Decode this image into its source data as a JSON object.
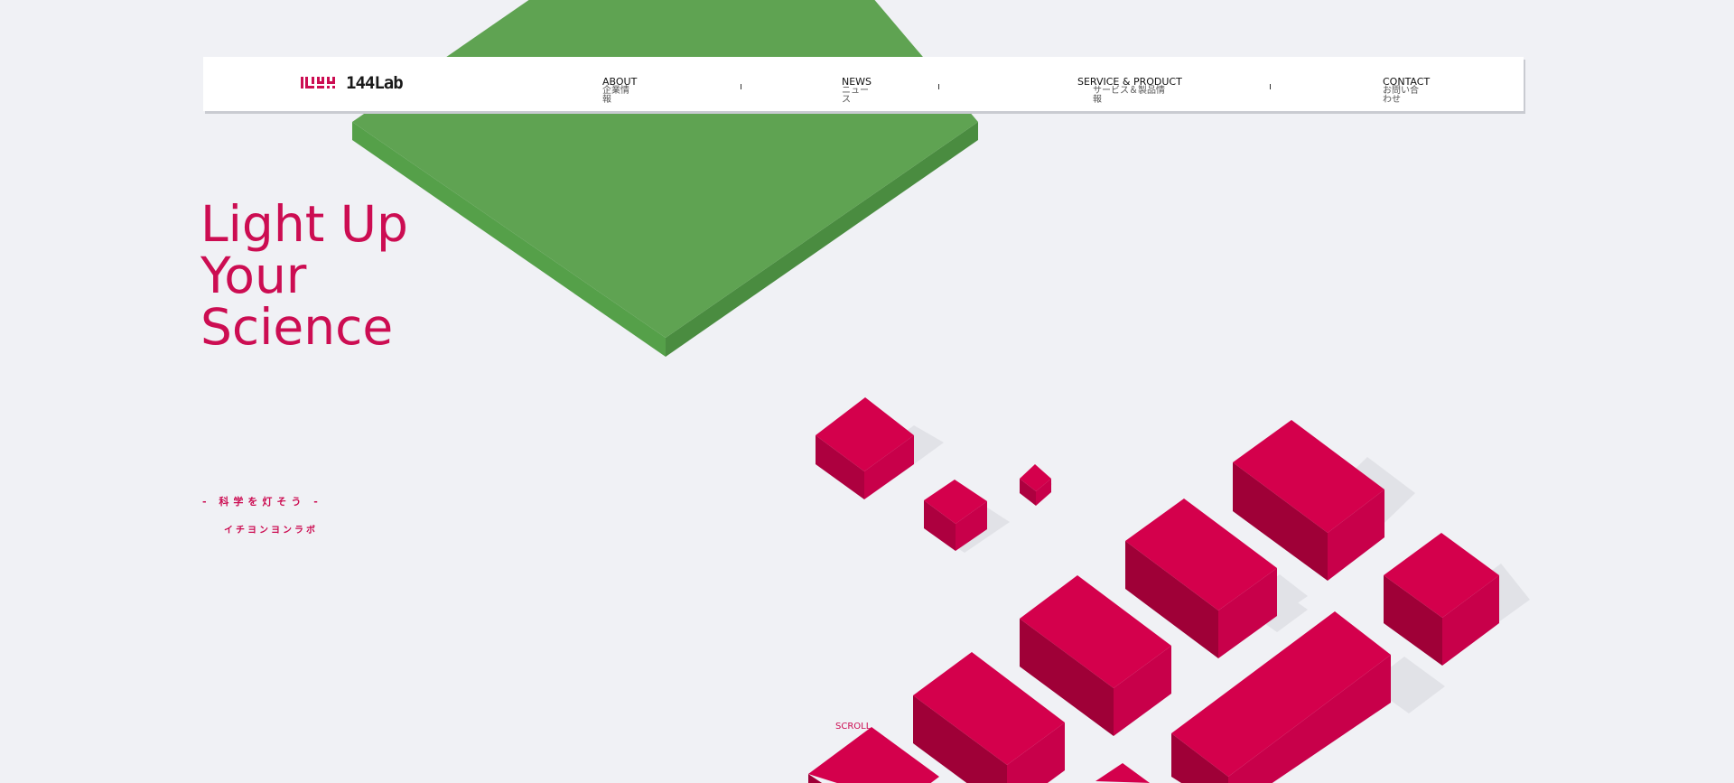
{
  "header": {
    "logo_text": "144Lab",
    "nav": [
      {
        "en": "ABOUT",
        "jp": "企業情報"
      },
      {
        "en": "NEWS",
        "jp": "ニュース"
      },
      {
        "en": "SERVICE & PRODUCT",
        "jp": "サービス＆製品情報"
      },
      {
        "en": "CONTACT",
        "jp": "お問い合わせ"
      }
    ]
  },
  "hero": {
    "title_lines": [
      "Light Up",
      "Your",
      "Science"
    ],
    "tagline": "- 科学を灯そう -",
    "tagline_kana": "イチヨンヨンラボ",
    "scroll_label": "SCROLL"
  },
  "colors": {
    "accent": "#cc0d52",
    "green": "#5fa352",
    "background": "#f0f1f5"
  }
}
